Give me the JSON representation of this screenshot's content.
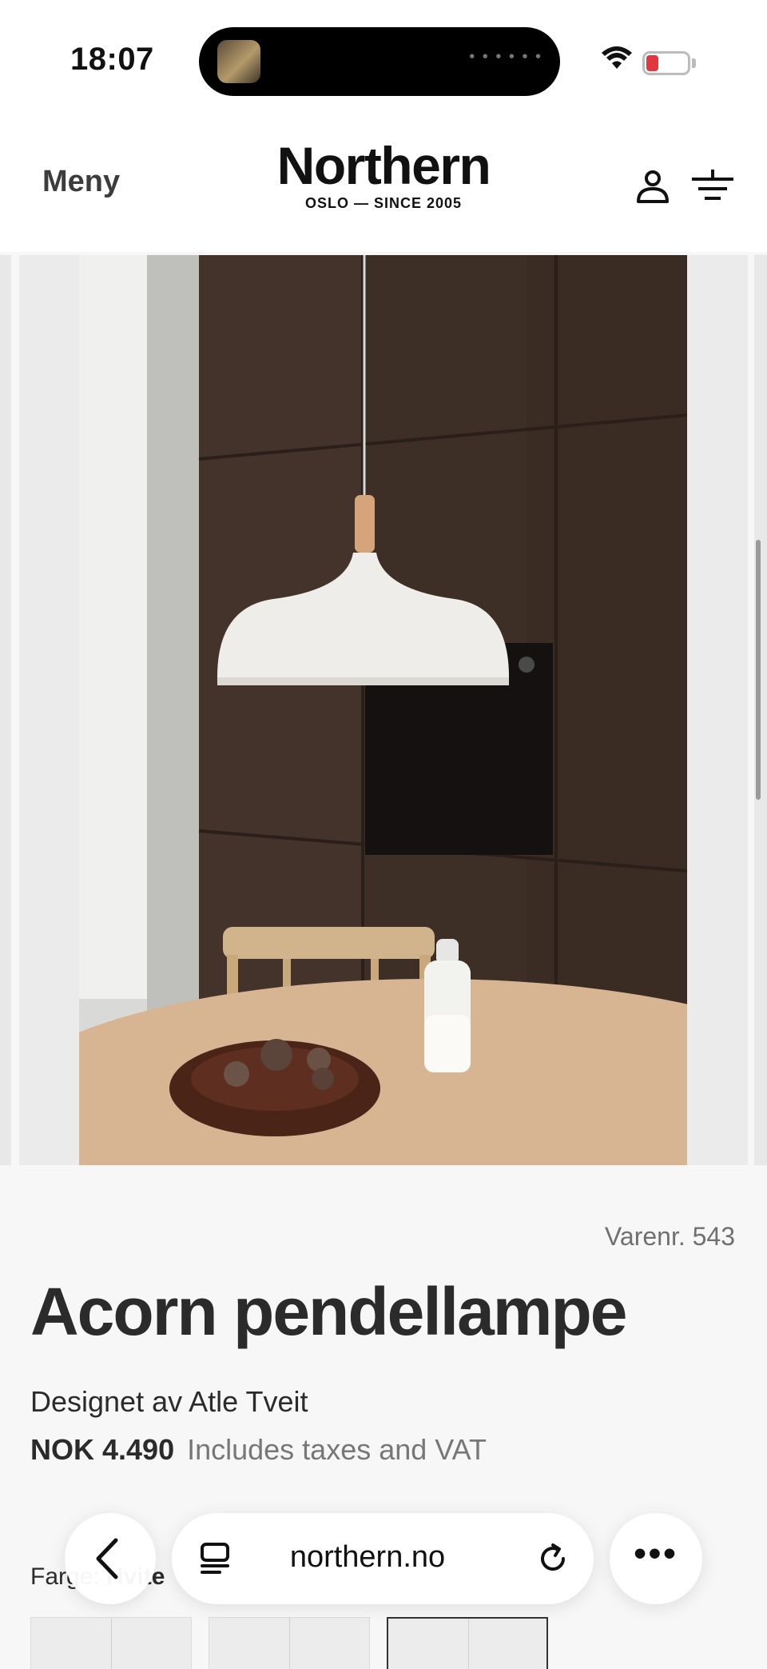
{
  "status_bar": {
    "time": "18:07",
    "battery_level": "16",
    "icons": [
      "wifi-icon",
      "battery-icon"
    ]
  },
  "header": {
    "menu_label": "Meny",
    "logo_name": "Northern",
    "logo_tagline": "OSLO — SINCE 2005",
    "icons": [
      "user-icon",
      "filter-icon"
    ]
  },
  "product": {
    "sku": "Varenr. 543",
    "title": "Acorn pendellampe",
    "designer": "Designet av Atle Tveit",
    "price": "NOK 4.490",
    "vat_note": "Includes taxes and VAT",
    "color_label": "Farge",
    "color_value": "Hvite"
  },
  "browser": {
    "url": "northern.no",
    "icons": [
      "back-icon",
      "tabs-icon",
      "reload-icon",
      "more-icon"
    ]
  },
  "colors": {
    "accent": "#2b2b2b",
    "battery_low": "#e0383e",
    "background": "#f7f7f7"
  }
}
